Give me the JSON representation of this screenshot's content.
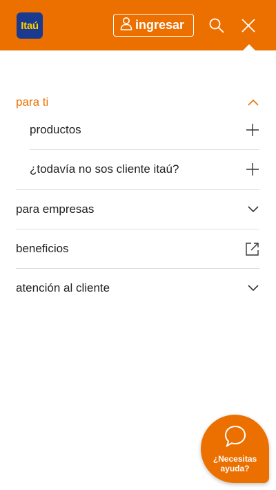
{
  "header": {
    "logo_text": "Itaú",
    "login_label": "ingresar",
    "icons": [
      "user-icon",
      "search-icon",
      "close-icon"
    ],
    "accent_color": "#ec7000",
    "logo_bg_color": "#1a3a8f",
    "logo_text_color": "#ffd000"
  },
  "menu": {
    "para_ti": {
      "label": "para ti",
      "state": "expanded"
    },
    "sub_items": [
      {
        "label": "productos"
      },
      {
        "label": "¿todavía no sos cliente itaú?"
      }
    ],
    "para_empresas": {
      "label": "para empresas"
    },
    "beneficios": {
      "label": "beneficios"
    },
    "atencion": {
      "label": "atención al cliente"
    }
  },
  "chat": {
    "line1": "¿Necesitas",
    "line2": "ayuda?"
  }
}
